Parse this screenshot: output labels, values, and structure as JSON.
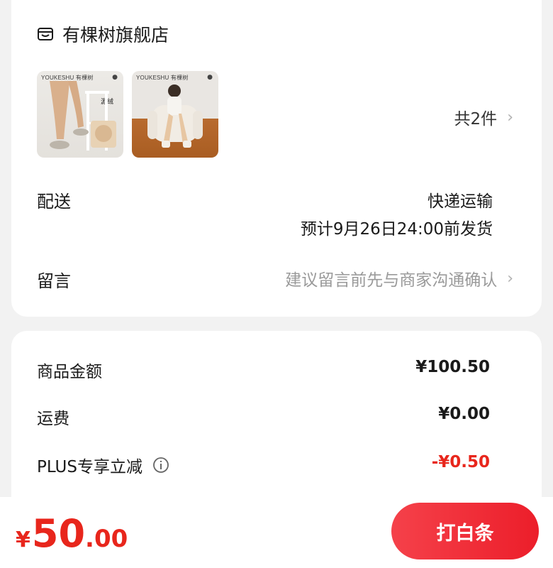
{
  "store": {
    "name": "有棵树旗舰店",
    "icon": "shop-icon"
  },
  "products": [
    {
      "brand_text": "YOUKESHU 有棵树",
      "tag": "源绒"
    },
    {
      "brand_text": "YOUKESHU 有棵树",
      "tag": ""
    }
  ],
  "item_count": "共2件",
  "delivery": {
    "label": "配送",
    "method": "快递运输",
    "eta": "预计9月26日24:00前发货"
  },
  "note": {
    "label": "留言",
    "placeholder": "建议留言前先与商家沟通确认"
  },
  "fees": {
    "goods_label": "商品金额",
    "goods_value": "¥100.50",
    "shipping_label": "运费",
    "shipping_value": "¥0.00",
    "discount_label": "PLUS专享立减",
    "discount_value": "-¥0.50"
  },
  "total": {
    "currency": "¥",
    "integer": "50",
    "decimal": ".00"
  },
  "pay_button": "打白条",
  "colors": {
    "accent_red": "#e8261c",
    "button_red": "#ec1e2a"
  }
}
